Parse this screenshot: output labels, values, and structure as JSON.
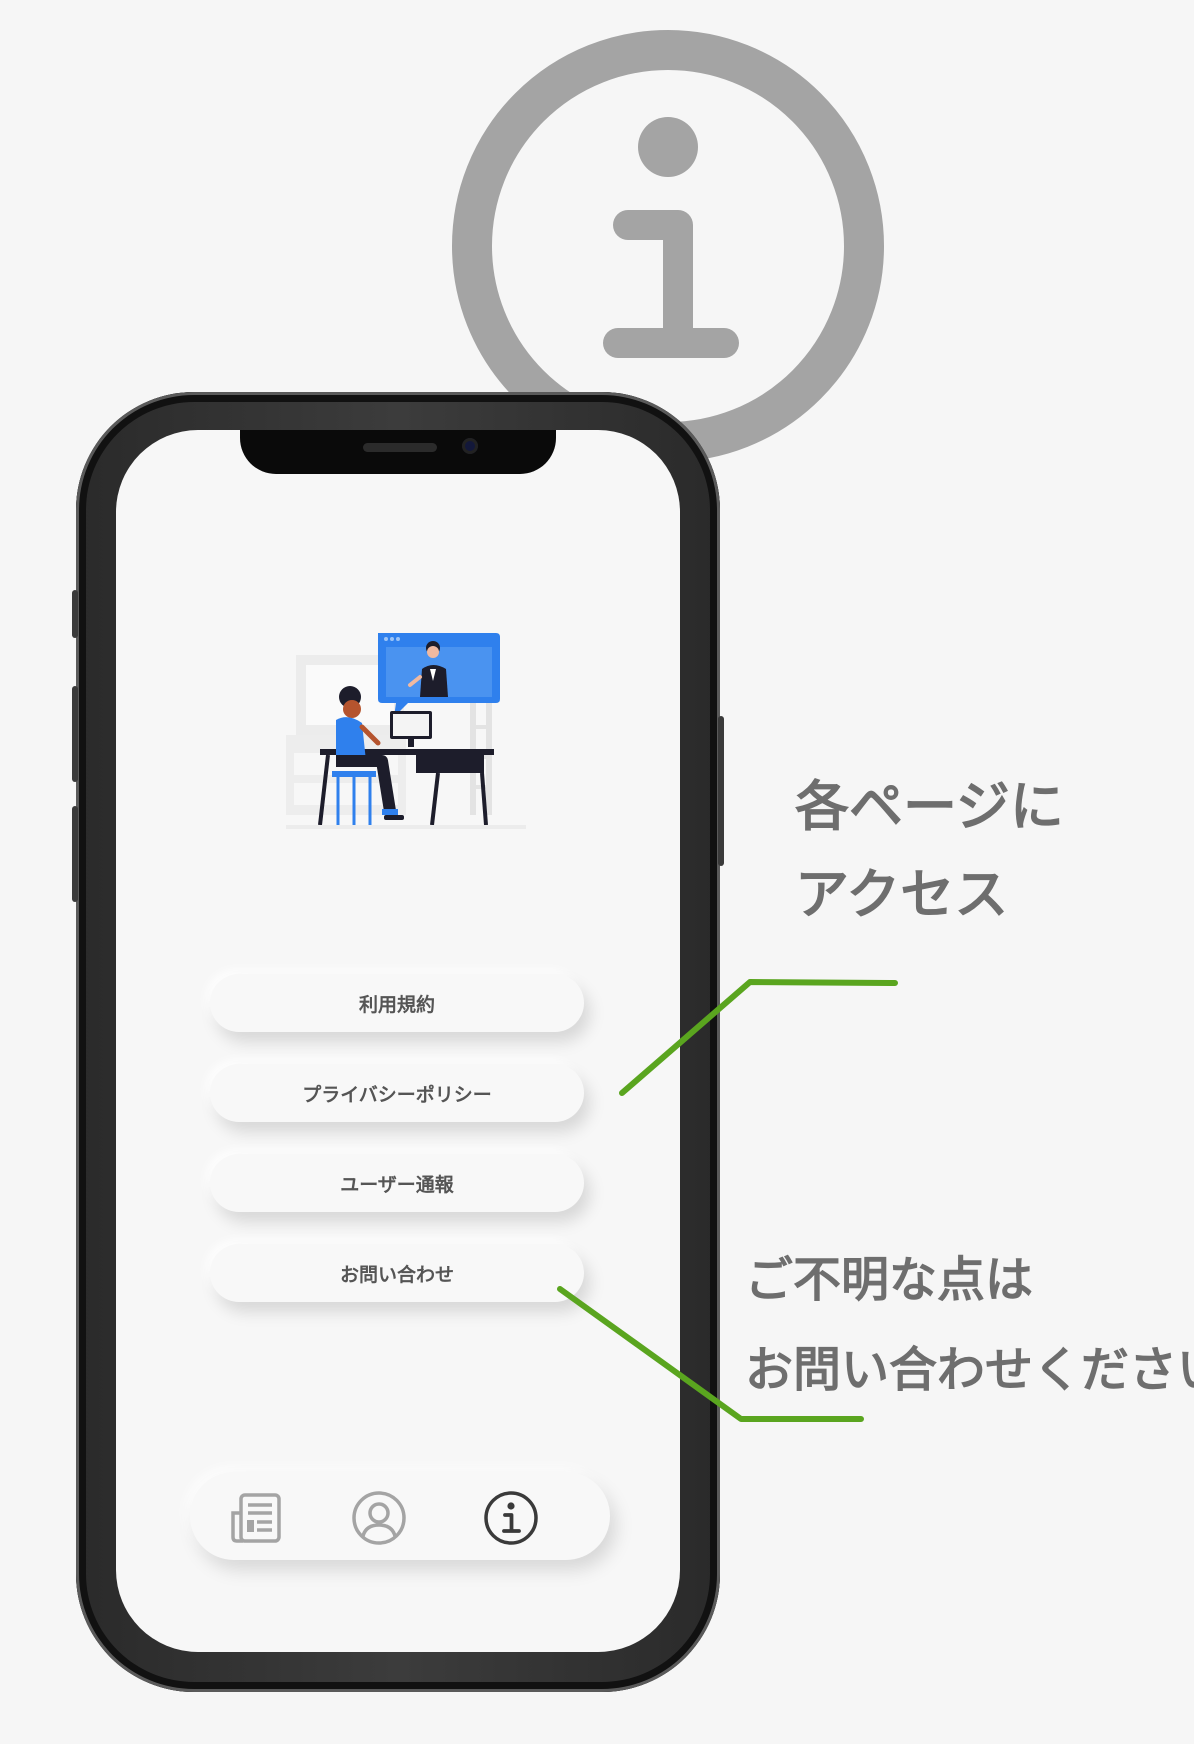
{
  "callouts": {
    "access_line1": "各ページに",
    "access_line2": "アクセス",
    "contact_line1": "ご不明な点は",
    "contact_line2": "お問い合わせください"
  },
  "menu": {
    "items": [
      {
        "label": "利用規約"
      },
      {
        "label": "プライバシーポリシー"
      },
      {
        "label": "ユーザー通報"
      },
      {
        "label": "お問い合わせ"
      }
    ]
  },
  "tabbar": {
    "tabs": [
      {
        "icon": "newspaper-icon",
        "active": false
      },
      {
        "icon": "profile-icon",
        "active": false
      },
      {
        "icon": "info-icon",
        "active": true
      }
    ]
  },
  "colors": {
    "background": "#f6f6f6",
    "callout_text": "#6e6e6e",
    "connector_green": "#5aa51f",
    "accent_blue": "#2f80ed",
    "icon_gray": "#a4a4a4"
  }
}
